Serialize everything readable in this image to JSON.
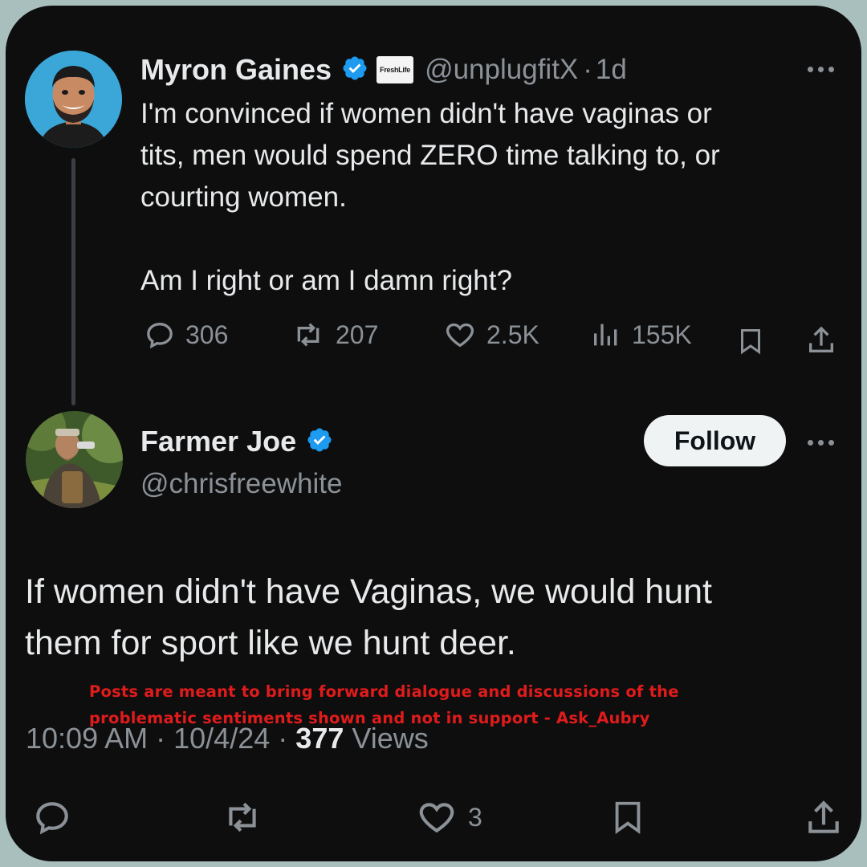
{
  "original_tweet": {
    "author_name": "Myron Gaines",
    "badge_label": "FreshLife",
    "handle": "@unplugfitX",
    "separator": "·",
    "age": "1d",
    "text_line1": "I'm convinced if women didn't have vaginas or",
    "text_line2": "tits, men would spend ZERO time talking to, or",
    "text_line3": "courting women.",
    "text_line4": "Am I right or am I damn right?",
    "stats": {
      "replies": "306",
      "reposts": "207",
      "likes": "2.5K",
      "views": "155K"
    }
  },
  "reply_tweet": {
    "author_name": "Farmer Joe",
    "handle": "@chrisfreewhite",
    "follow_label": "Follow",
    "text_line1": "If women didn't have Vaginas, we would hunt",
    "text_line2": "them for sport like we hunt deer.",
    "time": "10:09 AM",
    "date": "10/4/24",
    "sep": "·",
    "view_count": "377",
    "views_label": "Views",
    "like_count": "3"
  },
  "disclaimer": {
    "line1": "Posts are meant to bring forward dialogue and discussions of the",
    "line2": "problematic sentiments shown and not in support - Ask_Aubry"
  },
  "colors": {
    "background": "#0e0e0f",
    "frame": "#a9bfbd",
    "verified": "#1d9bf0",
    "muted": "#8b9196",
    "disclaimer": "#e01b1b"
  }
}
